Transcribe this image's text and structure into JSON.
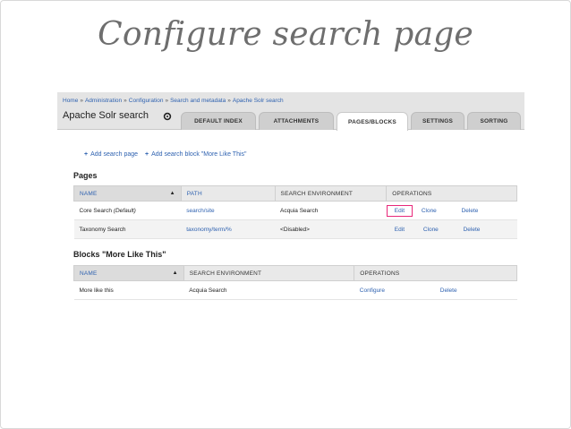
{
  "slide": {
    "title": "Configure search page"
  },
  "breadcrumb": [
    "Home",
    "Administration",
    "Configuration",
    "Search and metadata",
    "Apache Solr search"
  ],
  "breadcrumb_separator": "»",
  "header": {
    "page_title": "Apache Solr search"
  },
  "tabs": [
    "DEFAULT INDEX",
    "ATTACHMENTS",
    "PAGES/BLOCKS",
    "SETTINGS",
    "SORTING"
  ],
  "active_tab": "PAGES/BLOCKS",
  "actions": {
    "add_page": "Add search page",
    "add_block": "Add search block \"More Like This\""
  },
  "pages": {
    "title": "Pages",
    "columns": [
      "NAME",
      "PATH",
      "SEARCH ENVIRONMENT",
      "OPERATIONS"
    ],
    "rows": [
      {
        "name": "Core Search",
        "name_suffix": "(Default)",
        "path": "search/site",
        "environment": "Acquia Search",
        "edit": "Edit",
        "clone": "Clone",
        "delete": "Delete"
      },
      {
        "name": "Taxonomy Search",
        "name_suffix": "",
        "path": "taxonomy/term/%",
        "environment": "<Disabled>",
        "edit": "Edit",
        "clone": "Clone",
        "delete": "Delete"
      }
    ]
  },
  "blocks": {
    "title": "Blocks \"More Like This\"",
    "columns": [
      "NAME",
      "SEARCH ENVIRONMENT",
      "OPERATIONS"
    ],
    "rows": [
      {
        "name": "More like this",
        "environment": "Acquia Search",
        "configure": "Configure",
        "delete": "Delete"
      }
    ]
  },
  "colors": {
    "link": "#2f62b0",
    "highlight": "#e8287a",
    "title": "#6e6e6e"
  },
  "icons": {
    "gear": "gear-icon",
    "sort": "sort-ascending-icon",
    "add": "plus-icon"
  }
}
